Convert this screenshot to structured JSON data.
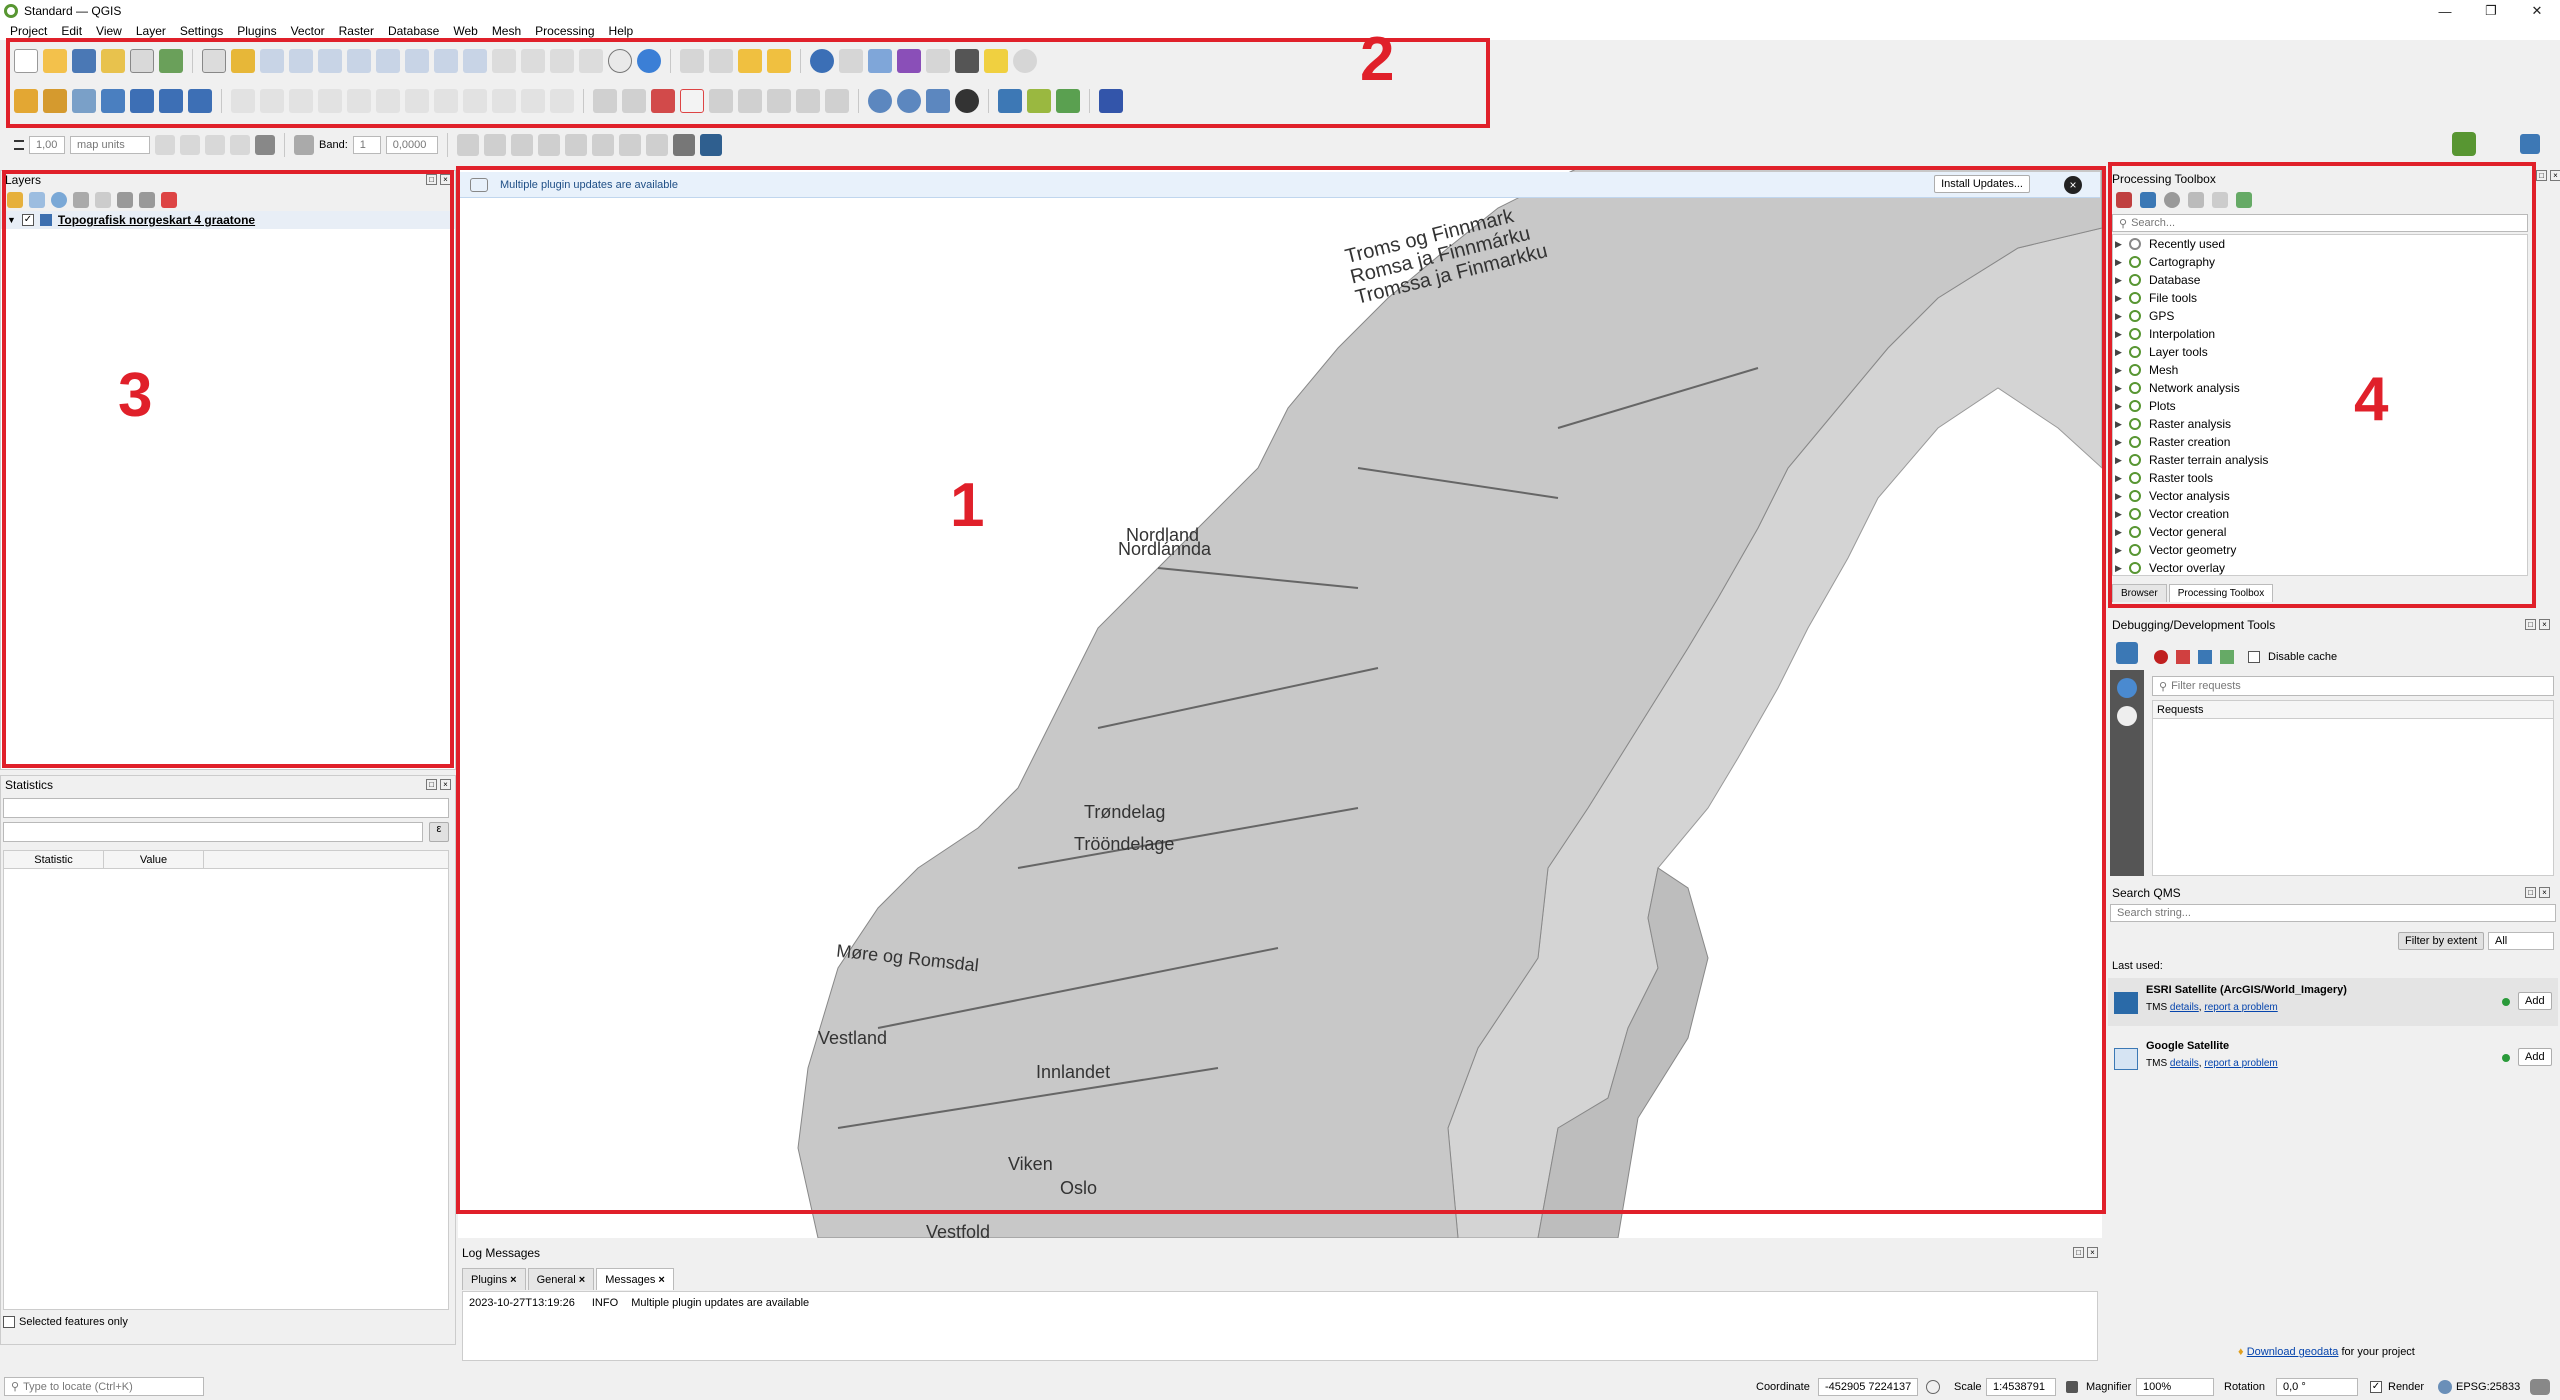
{
  "window": {
    "title": "Standard — QGIS"
  },
  "menu": [
    "Project",
    "Edit",
    "View",
    "Layer",
    "Settings",
    "Plugins",
    "Vector",
    "Raster",
    "Database",
    "Web",
    "Mesh",
    "Processing",
    "Help"
  ],
  "toolbar3": {
    "width_value": "1,00",
    "units": "map units",
    "band_label": "Band:",
    "band_value": "1",
    "offset_value": "0,0000"
  },
  "annotations": {
    "map": "1",
    "toolbars": "2",
    "layers": "3",
    "processing": "4"
  },
  "layers_panel": {
    "title": "Layers",
    "layer_name": "Topografisk norgeskart 4 graatone"
  },
  "statistics_panel": {
    "title": "Statistics",
    "col_statistic": "Statistic",
    "col_value": "Value",
    "selected_only": "Selected features only"
  },
  "locator": {
    "placeholder": "Type to locate (Ctrl+K)"
  },
  "message_bar": {
    "text": "Multiple plugin updates are available",
    "button": "Install Updates..."
  },
  "map_labels": {
    "troms1": "Troms og Finnmark",
    "troms2": "Romsa ja Finnmárku",
    "troms3": "Tromssa ja Finmarkku",
    "nordland1": "Nordland",
    "nordland2": "Nordlánnda",
    "trondelag1": "Trøndelag",
    "trondelag2": "Trööndelage",
    "more": "Møre og Romsdal",
    "vestland": "Vestland",
    "innlandet": "Innlandet",
    "viken": "Viken",
    "oslo": "Oslo",
    "vestfold": "Vestfold"
  },
  "processing": {
    "title": "Processing Toolbox",
    "search_placeholder": "Search...",
    "items": [
      "Recently used",
      "Cartography",
      "Database",
      "File tools",
      "GPS",
      "Interpolation",
      "Layer tools",
      "Mesh",
      "Network analysis",
      "Plots",
      "Raster analysis",
      "Raster creation",
      "Raster terrain analysis",
      "Raster tools",
      "Vector analysis",
      "Vector creation",
      "Vector general",
      "Vector geometry",
      "Vector overlay"
    ],
    "tabs": [
      "Browser",
      "Processing Toolbox"
    ]
  },
  "debug": {
    "title": "Debugging/Development Tools",
    "disable_cache": "Disable cache",
    "filter_placeholder": "Filter requests",
    "requests_header": "Requests"
  },
  "qms": {
    "title": "Search QMS",
    "search_placeholder": "Search string...",
    "filter_btn": "Filter by extent",
    "filter_value": "All",
    "last_used": "Last used:",
    "services": [
      {
        "name": "ESRI Satellite (ArcGIS/World_Imagery)",
        "type": "TMS",
        "details": "details",
        "report": "report a problem",
        "add": "Add"
      },
      {
        "name": "Google Satellite",
        "type": "TMS",
        "details": "details",
        "report": "report a problem",
        "add": "Add"
      }
    ],
    "download_link": "Download geodata",
    "download_suffix": "for your project"
  },
  "log": {
    "title": "Log Messages",
    "tabs": [
      "Plugins",
      "General",
      "Messages"
    ],
    "entry_time": "2023-10-27T13:19:26",
    "entry_level": "INFO",
    "entry_text": "Multiple plugin updates are available"
  },
  "status": {
    "coord_label": "Coordinate",
    "coord_value": "-452905  7224137",
    "scale_label": "Scale",
    "scale_value": "1:4538791",
    "magnifier_label": "Magnifier",
    "magnifier_value": "100%",
    "rotation_label": "Rotation",
    "rotation_value": "0,0 °",
    "render_label": "Render",
    "crs": "EPSG:25833"
  }
}
